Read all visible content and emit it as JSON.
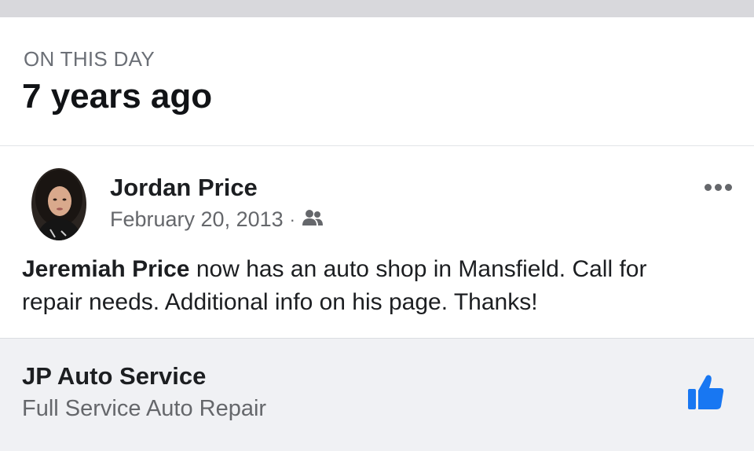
{
  "memory": {
    "overline": "ON THIS DAY",
    "title": "7 years ago"
  },
  "post": {
    "author": "Jordan Price",
    "date": "February 20, 2013",
    "separator": "·",
    "audience_icon": "friends-icon",
    "mention": "Jeremiah Price",
    "text_line1": " now has an auto shop in Mansfield. Call for",
    "text_line2": "repair needs. Additional info on his page.  Thanks!",
    "more_icon": "more-options-icon"
  },
  "link_card": {
    "title": "JP Auto Service",
    "subtitle": "Full Service Auto Repair",
    "action_icon": "thumbs-up-icon",
    "accent_color": "#1877f2"
  }
}
